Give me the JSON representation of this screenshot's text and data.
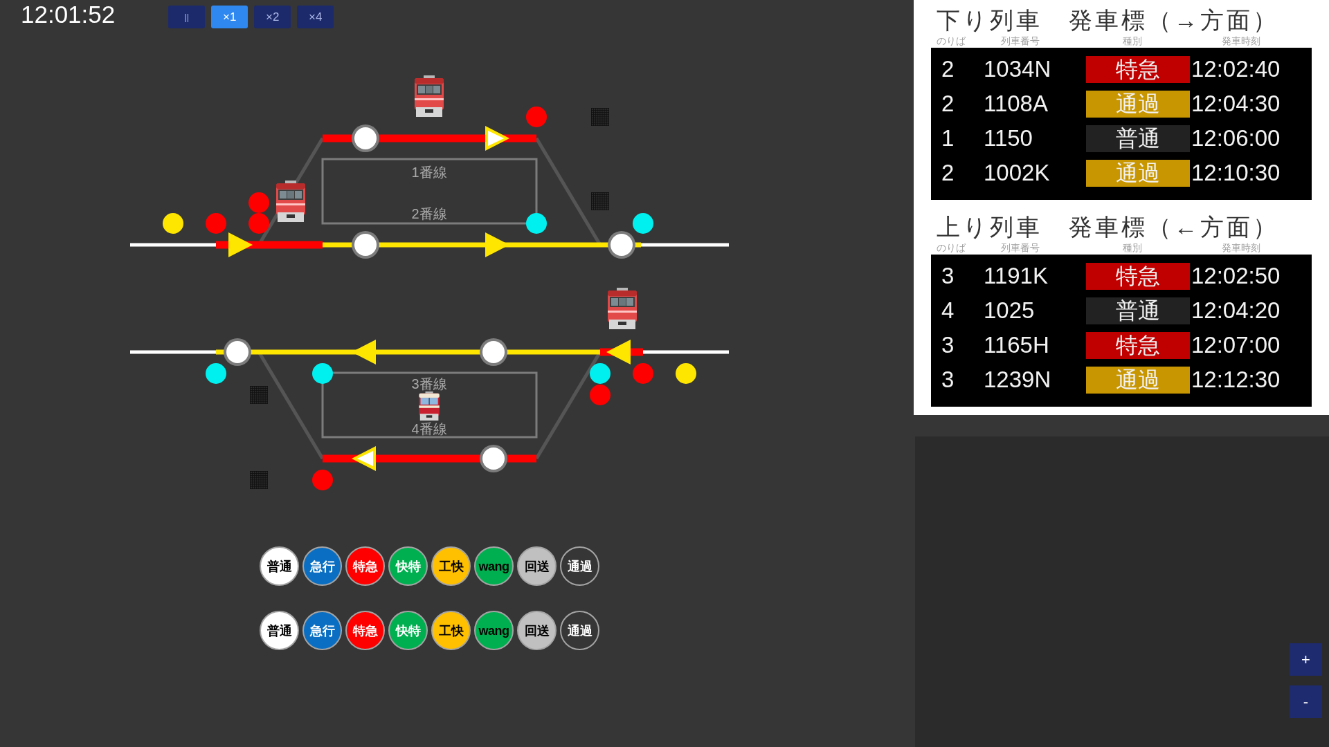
{
  "clock": {
    "time": "12:01:52"
  },
  "speed_buttons": [
    {
      "label": "||",
      "selected": false
    },
    {
      "label": "×1",
      "selected": true
    },
    {
      "label": "×2",
      "selected": false
    },
    {
      "label": "×4",
      "selected": false
    }
  ],
  "diagram": {
    "platform_labels": [
      "1番線",
      "2番線",
      "3番線",
      "4番線"
    ],
    "track_segments": [
      {
        "color": "#555555"
      },
      {
        "color": "#555555"
      },
      {
        "color": "#555555"
      },
      {
        "color": "#555555"
      },
      {
        "color": "#ff0000"
      },
      {
        "color": "#ffffff"
      },
      {
        "color": "#ff0000"
      },
      {
        "color": "#ffe600"
      },
      {
        "color": "#ffffff"
      },
      {
        "color": "#ffffff"
      },
      {
        "color": "#ffe600"
      },
      {
        "color": "#ff0000"
      },
      {
        "color": "#ffffff"
      },
      {
        "color": "#ff0000"
      }
    ],
    "direction_arrows": [
      {
        "kind": "hollow"
      },
      {
        "kind": "solid"
      },
      {
        "kind": "solid"
      },
      {
        "kind": "solid"
      },
      {
        "kind": "solid"
      },
      {
        "kind": "hollow"
      }
    ],
    "signals": [
      {
        "color": "#ff0000"
      },
      {
        "color": "#ff0000"
      },
      {
        "color": "#ffe600"
      },
      {
        "color": "#ff0000"
      },
      {
        "color": "#ff0000"
      },
      {
        "color": "#00f0f0"
      },
      {
        "color": "#00f0f0"
      },
      {
        "color": "#00f0f0"
      },
      {
        "color": "#00f0f0"
      },
      {
        "color": "#00f0f0"
      },
      {
        "color": "#ff0000"
      },
      {
        "color": "#ffe600"
      },
      {
        "color": "#ff0000"
      },
      {
        "color": "#ff0000"
      }
    ],
    "trains": [
      {
        "kind": "plain"
      },
      {
        "kind": "plain"
      },
      {
        "kind": "plain"
      },
      {
        "kind": "banded"
      }
    ]
  },
  "type_button_rows": [
    {
      "buttons": [
        {
          "label": {
            "text": "普通",
            "color": "#000000"
          },
          "color": "#ffffff"
        },
        {
          "label": {
            "text": "急行",
            "color": "#ffffff"
          },
          "color": "#0a6fc2"
        },
        {
          "label": {
            "text": "特急",
            "color": "#ffffff"
          },
          "color": "#ff0000"
        },
        {
          "label": {
            "text": "快特",
            "color": "#ffffff"
          },
          "color": "#00b050"
        },
        {
          "label": {
            "text": "工快",
            "color": "#000000"
          },
          "color": "#ffc000"
        },
        {
          "label": {
            "text": "wang",
            "color": "#000000"
          },
          "color": "#00b050"
        },
        {
          "label": {
            "text": "回送",
            "color": "#000000"
          },
          "color": "#c0c0c0"
        },
        {
          "label": {
            "text": "通過",
            "color": "#ffffff"
          },
          "color": "#363636"
        }
      ]
    },
    {
      "buttons": [
        {
          "label": {
            "text": "普通",
            "color": "#000000"
          },
          "color": "#ffffff"
        },
        {
          "label": {
            "text": "急行",
            "color": "#ffffff"
          },
          "color": "#0a6fc2"
        },
        {
          "label": {
            "text": "特急",
            "color": "#ffffff"
          },
          "color": "#ff0000"
        },
        {
          "label": {
            "text": "快特",
            "color": "#ffffff"
          },
          "color": "#00b050"
        },
        {
          "label": {
            "text": "工快",
            "color": "#000000"
          },
          "color": "#ffc000"
        },
        {
          "label": {
            "text": "wang",
            "color": "#000000"
          },
          "color": "#00b050"
        },
        {
          "label": {
            "text": "回送",
            "color": "#000000"
          },
          "color": "#c0c0c0"
        },
        {
          "label": {
            "text": "通過",
            "color": "#ffffff"
          },
          "color": "#363636"
        }
      ]
    }
  ],
  "departure_boards": [
    {
      "title": "下り列車　発車標（→方面）",
      "columns": [
        "のりば",
        "列車番号",
        "種別",
        "発車時刻"
      ],
      "rows": [
        {
          "platform": "2",
          "train_number": "1034N",
          "type": {
            "label": "特急",
            "color": "#c00000"
          },
          "departure": "12:02:40"
        },
        {
          "platform": "2",
          "train_number": "1108A",
          "type": {
            "label": "通過",
            "color": "#c89600"
          },
          "departure": "12:04:30"
        },
        {
          "platform": "1",
          "train_number": "1150",
          "type": {
            "label": "普通",
            "color": "#222222"
          },
          "departure": "12:06:00"
        },
        {
          "platform": "2",
          "train_number": "1002K",
          "type": {
            "label": "通過",
            "color": "#c89600"
          },
          "departure": "12:10:30"
        }
      ]
    },
    {
      "title": "上り列車　発車標（←方面）",
      "columns": [
        "のりば",
        "列車番号",
        "種別",
        "発車時刻"
      ],
      "rows": [
        {
          "platform": "3",
          "train_number": "1191K",
          "type": {
            "label": "特急",
            "color": "#c00000"
          },
          "departure": "12:02:50"
        },
        {
          "platform": "4",
          "train_number": "1025",
          "type": {
            "label": "普通",
            "color": "#222222"
          },
          "departure": "12:04:20"
        },
        {
          "platform": "3",
          "train_number": "1165H",
          "type": {
            "label": "特急",
            "color": "#c00000"
          },
          "departure": "12:07:00"
        },
        {
          "platform": "3",
          "train_number": "1239N",
          "type": {
            "label": "通過",
            "color": "#c89600"
          },
          "departure": "12:12:30"
        }
      ]
    }
  ],
  "zoom_buttons": [
    "+",
    "-"
  ]
}
